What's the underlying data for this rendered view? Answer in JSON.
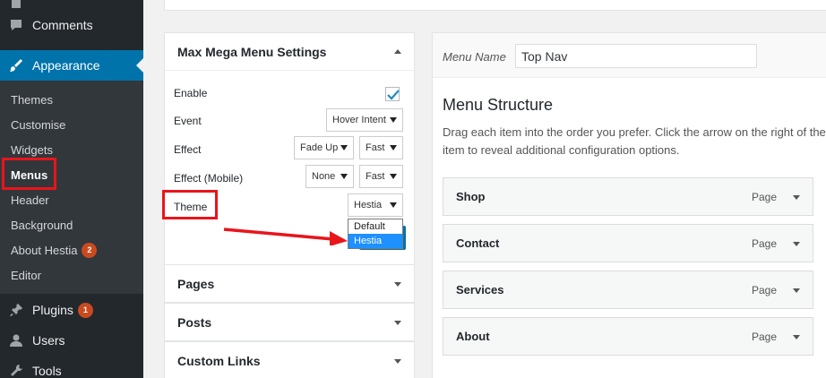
{
  "sidebar": {
    "top_items": [
      {
        "label": "Comments",
        "icon": "comment-icon"
      },
      {
        "label": "Appearance",
        "icon": "paintbrush-icon"
      }
    ],
    "submenu": [
      {
        "label": "Themes"
      },
      {
        "label": "Customise"
      },
      {
        "label": "Widgets"
      },
      {
        "label": "Menus"
      },
      {
        "label": "Header"
      },
      {
        "label": "Background"
      },
      {
        "label": "About Hestia",
        "badge": "2"
      },
      {
        "label": "Editor"
      }
    ],
    "bottom_items": [
      {
        "label": "Plugins",
        "badge": "1",
        "icon": "plugin-icon"
      },
      {
        "label": "Users",
        "icon": "users-icon"
      },
      {
        "label": "Tools",
        "icon": "wrench-icon"
      }
    ]
  },
  "mmm": {
    "title": "Max Mega Menu Settings",
    "enable_label": "Enable",
    "enable_checked": true,
    "event_label": "Event",
    "event_value": "Hover Intent",
    "effect_label": "Effect",
    "effect_value": "Fade Up",
    "effect_speed": "Fast",
    "effect_mobile_label": "Effect (Mobile)",
    "effect_mobile_value": "None",
    "effect_mobile_speed": "Fast",
    "theme_label": "Theme",
    "theme_value": "Hestia",
    "theme_options": [
      "Default",
      "Hestia"
    ],
    "theme_selected_option": "Hestia"
  },
  "accordions": [
    {
      "label": "Pages"
    },
    {
      "label": "Posts"
    },
    {
      "label": "Custom Links"
    }
  ],
  "menu_editor": {
    "name_label": "Menu Name",
    "name_value": "Top Nav",
    "structure_title": "Menu Structure",
    "structure_desc": "Drag each item into the order you prefer. Click the arrow on the right of the item to reveal additional configuration options.",
    "items": [
      {
        "label": "Shop",
        "type": "Page"
      },
      {
        "label": "Contact",
        "type": "Page"
      },
      {
        "label": "Services",
        "type": "Page"
      },
      {
        "label": "About",
        "type": "Page"
      }
    ]
  },
  "colors": {
    "sidebar_bg": "#23282d",
    "accent": "#0073aa",
    "highlight": "#e8151b"
  }
}
